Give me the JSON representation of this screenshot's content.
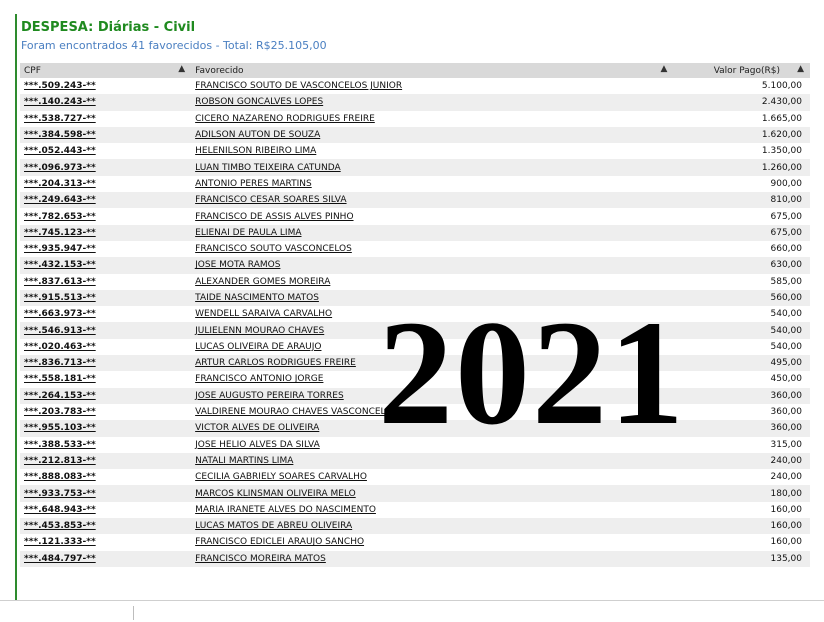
{
  "header": {
    "title": "DESPESA: Diárias - Civil",
    "subtitle": "Foram encontrados 41 favorecidos - Total: R$25.105,00"
  },
  "table": {
    "columns": [
      "CPF",
      "Favorecido",
      "Valor Pago(R$)"
    ],
    "rows": [
      {
        "cpf": "***.509.243-**",
        "name": "FRANCISCO SOUTO DE VASCONCELOS JUNIOR",
        "value": "5.100,00"
      },
      {
        "cpf": "***.140.243-**",
        "name": "ROBSON GONCALVES LOPES",
        "value": "2.430,00"
      },
      {
        "cpf": "***.538.727-**",
        "name": "CICERO NAZARENO RODRIGUES FREIRE",
        "value": "1.665,00"
      },
      {
        "cpf": "***.384.598-**",
        "name": "ADILSON AUTON DE SOUZA",
        "value": "1.620,00"
      },
      {
        "cpf": "***.052.443-**",
        "name": "HELENILSON RIBEIRO LIMA",
        "value": "1.350,00"
      },
      {
        "cpf": "***.096.973-**",
        "name": "LUAN TIMBO TEIXEIRA CATUNDA",
        "value": "1.260,00"
      },
      {
        "cpf": "***.204.313-**",
        "name": "ANTONIO PERES MARTINS",
        "value": "900,00"
      },
      {
        "cpf": "***.249.643-**",
        "name": "FRANCISCO CESAR SOARES SILVA",
        "value": "810,00"
      },
      {
        "cpf": "***.782.653-**",
        "name": "FRANCISCO DE ASSIS ALVES PINHO",
        "value": "675,00"
      },
      {
        "cpf": "***.745.123-**",
        "name": "ELIENAI DE PAULA LIMA",
        "value": "675,00"
      },
      {
        "cpf": "***.935.947-**",
        "name": "FRANCISCO SOUTO VASCONCELOS",
        "value": "660,00"
      },
      {
        "cpf": "***.432.153-**",
        "name": "JOSE MOTA RAMOS",
        "value": "630,00"
      },
      {
        "cpf": "***.837.613-**",
        "name": "ALEXANDER GOMES MOREIRA",
        "value": "585,00"
      },
      {
        "cpf": "***.915.513-**",
        "name": "TAIDE NASCIMENTO MATOS",
        "value": "560,00"
      },
      {
        "cpf": "***.663.973-**",
        "name": "WENDELL SARAIVA CARVALHO",
        "value": "540,00"
      },
      {
        "cpf": "***.546.913-**",
        "name": "JULIELENN MOURAO CHAVES",
        "value": "540,00"
      },
      {
        "cpf": "***.020.463-**",
        "name": "LUCAS OLIVEIRA DE ARAUJO",
        "value": "540,00"
      },
      {
        "cpf": "***.836.713-**",
        "name": "ARTUR CARLOS RODRIGUES FREIRE",
        "value": "495,00"
      },
      {
        "cpf": "***.558.181-**",
        "name": "FRANCISCO ANTONIO JORGE",
        "value": "450,00"
      },
      {
        "cpf": "***.264.153-**",
        "name": "JOSE AUGUSTO PEREIRA TORRES",
        "value": "360,00"
      },
      {
        "cpf": "***.203.783-**",
        "name": "VALDIRENE MOURAO CHAVES VASCONCELOS",
        "value": "360,00"
      },
      {
        "cpf": "***.955.103-**",
        "name": "VICTOR ALVES DE OLIVEIRA",
        "value": "360,00"
      },
      {
        "cpf": "***.388.533-**",
        "name": "JOSE HELIO ALVES DA SILVA",
        "value": "315,00"
      },
      {
        "cpf": "***.212.813-**",
        "name": "NATALI MARTINS LIMA",
        "value": "240,00"
      },
      {
        "cpf": "***.888.083-**",
        "name": "CECILIA GABRIELY SOARES CARVALHO",
        "value": "240,00"
      },
      {
        "cpf": "***.933.753-**",
        "name": "MARCOS KLINSMAN OLIVEIRA MELO",
        "value": "180,00"
      },
      {
        "cpf": "***.648.943-**",
        "name": "MARIA IRANETE ALVES DO NASCIMENTO",
        "value": "160,00"
      },
      {
        "cpf": "***.453.853-**",
        "name": "LUCAS MATOS DE ABREU OLIVEIRA",
        "value": "160,00"
      },
      {
        "cpf": "***.121.333-**",
        "name": "FRANCISCO EDICLEI ARAUJO SANCHO",
        "value": "160,00"
      },
      {
        "cpf": "***.484.797-**",
        "name": "FRANCISCO MOREIRA MATOS",
        "value": "135,00"
      }
    ]
  },
  "watermark": "2021",
  "colors": {
    "title": "#1f8a1f",
    "subtitle": "#4a7fc1",
    "header_bg": "#d9d9d9",
    "stripe": "#eeeeee"
  }
}
